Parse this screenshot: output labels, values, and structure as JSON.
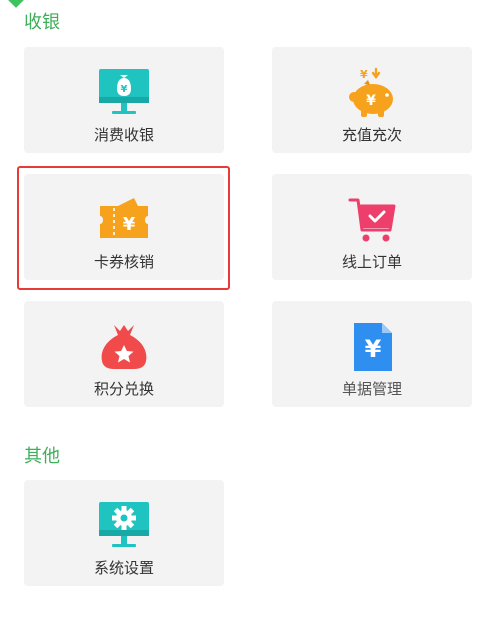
{
  "sections": [
    {
      "title": "收银",
      "items": [
        {
          "label": "消费收银",
          "icon": "monitor-yen-icon"
        },
        {
          "label": "充值充次",
          "icon": "piggy-bank-icon"
        },
        {
          "label": "卡券核销",
          "icon": "ticket-yen-icon"
        },
        {
          "label": "线上订单",
          "icon": "shopping-cart-icon"
        },
        {
          "label": "积分兑换",
          "icon": "money-bag-star-icon"
        },
        {
          "label": "单据管理",
          "icon": "document-yen-icon"
        }
      ]
    },
    {
      "title": "其他",
      "items": [
        {
          "label": "系统设置",
          "icon": "monitor-gear-icon"
        }
      ]
    }
  ],
  "selected": "卡券核销",
  "colors": {
    "section_title": "#3fae5a",
    "tile_bg": "#f3f3f3",
    "selection_border": "#e83b35",
    "teal": "#1fc3c0",
    "orange": "#f7a21c",
    "pink": "#ee3e6b",
    "red": "#f04a4a",
    "blue": "#2f8ff0"
  }
}
